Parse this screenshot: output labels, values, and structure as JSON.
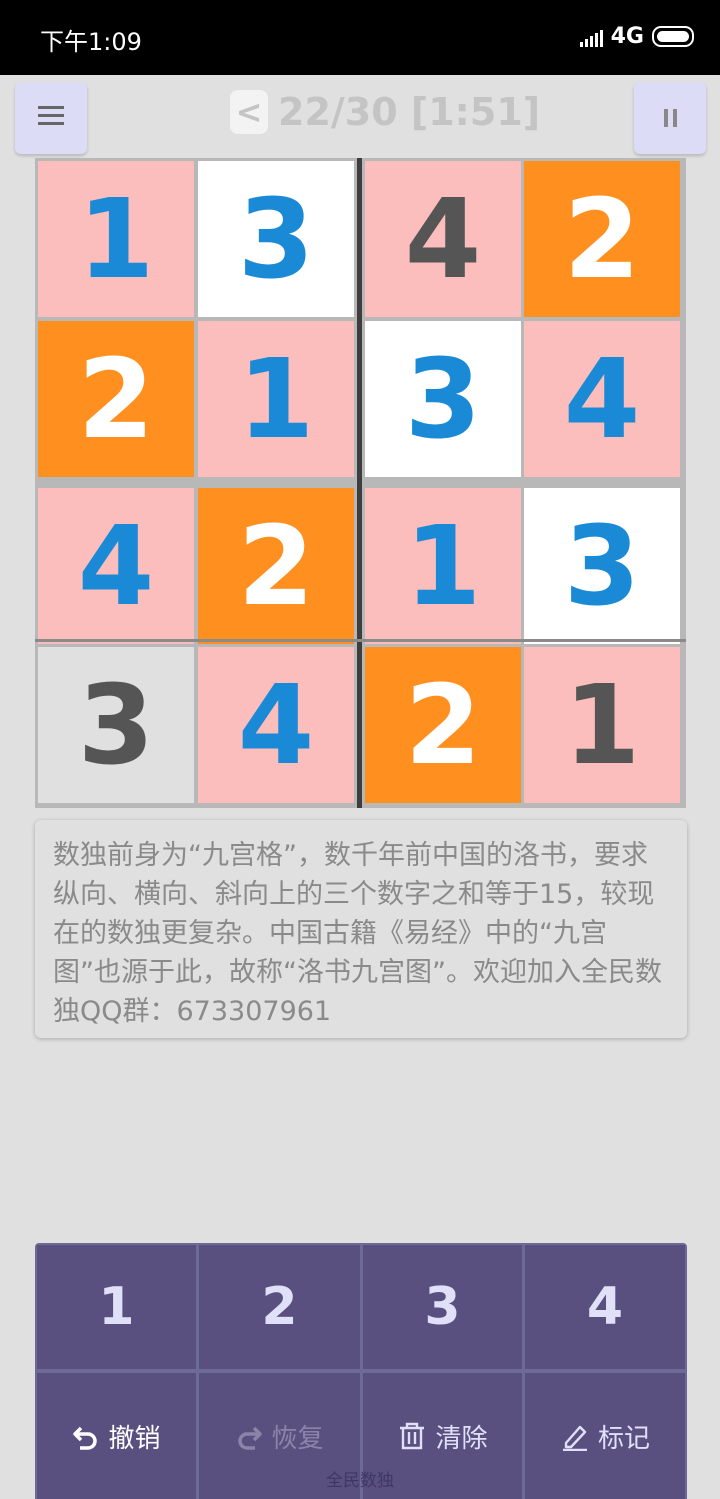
{
  "status_bar": {
    "time": "下午1:09",
    "network": "4G"
  },
  "header": {
    "prev_label": "<",
    "title": "22/30 [1:51]"
  },
  "board": {
    "cells": [
      {
        "value": "1",
        "bg": "#fcbdbd",
        "fg": "#1a8ad6"
      },
      {
        "value": "3",
        "bg": "#ffffff",
        "fg": "#1a8ad6"
      },
      {
        "value": "4",
        "bg": "#fcbdbd",
        "fg": "#555555"
      },
      {
        "value": "2",
        "bg": "#ff9020",
        "fg": "#ffffff"
      },
      {
        "value": "2",
        "bg": "#ff9020",
        "fg": "#ffffff"
      },
      {
        "value": "1",
        "bg": "#fcbdbd",
        "fg": "#1a8ad6"
      },
      {
        "value": "3",
        "bg": "#ffffff",
        "fg": "#1a8ad6"
      },
      {
        "value": "4",
        "bg": "#fcbdbd",
        "fg": "#1a8ad6"
      },
      {
        "value": "4",
        "bg": "#fcbdbd",
        "fg": "#1a8ad6"
      },
      {
        "value": "2",
        "bg": "#ff9020",
        "fg": "#ffffff"
      },
      {
        "value": "1",
        "bg": "#fcbdbd",
        "fg": "#1a8ad6"
      },
      {
        "value": "3",
        "bg": "#ffffff",
        "fg": "#1a8ad6"
      },
      {
        "value": "3",
        "bg": "#e0e0e0",
        "fg": "#555555"
      },
      {
        "value": "4",
        "bg": "#fcbdbd",
        "fg": "#1a8ad6"
      },
      {
        "value": "2",
        "bg": "#ff9020",
        "fg": "#ffffff"
      },
      {
        "value": "1",
        "bg": "#fcbdbd",
        "fg": "#555555"
      }
    ]
  },
  "info": {
    "text": "数独前身为“九宫格”，数千年前中国的洛书，要求纵向、横向、斜向上的三个数字之和等于15，较现在的数独更复杂。中国古籍《易经》中的“九宫图”也源于此，故称“洛书九宫图”。欢迎加入全民数独QQ群：673307961"
  },
  "keypad": {
    "numbers": [
      "1",
      "2",
      "3",
      "4"
    ],
    "actions": {
      "undo": "撤销",
      "redo": "恢复",
      "clear": "清除",
      "mark": "标记"
    }
  },
  "footer": {
    "app_name": "全民数独"
  }
}
